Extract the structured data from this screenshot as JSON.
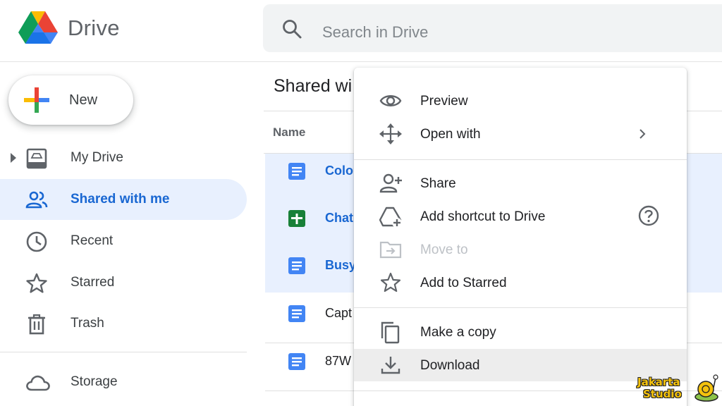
{
  "app": {
    "brand": "Drive"
  },
  "search": {
    "placeholder": "Search in Drive"
  },
  "sidebar": {
    "new_label": "New",
    "items": [
      {
        "label": "My Drive",
        "icon": "my-drive-icon"
      },
      {
        "label": "Shared with me",
        "icon": "people-icon",
        "active": true
      },
      {
        "label": "Recent",
        "icon": "clock-icon"
      },
      {
        "label": "Starred",
        "icon": "star-icon"
      },
      {
        "label": "Trash",
        "icon": "trash-icon"
      },
      {
        "label": "Storage",
        "icon": "cloud-icon"
      }
    ]
  },
  "main": {
    "title": "Shared wi",
    "column_name": "Name",
    "files": [
      {
        "name": "Colo",
        "type": "doc",
        "selected": true
      },
      {
        "name": "Chat",
        "type": "sheet",
        "selected": true
      },
      {
        "name": "Busy",
        "type": "doc",
        "selected": true
      },
      {
        "name": "Capt",
        "type": "doc",
        "selected": false
      },
      {
        "name": "87W",
        "type": "doc",
        "selected": false
      }
    ]
  },
  "context_menu": {
    "items": [
      {
        "label": "Preview",
        "icon": "eye-icon"
      },
      {
        "label": "Open with",
        "icon": "move-arrows-icon",
        "submenu": true
      },
      {
        "label": "Share",
        "icon": "person-add-icon"
      },
      {
        "label": "Add shortcut to Drive",
        "icon": "add-shortcut-icon",
        "help": true
      },
      {
        "label": "Move to",
        "icon": "folder-move-icon",
        "disabled": true
      },
      {
        "label": "Add to Starred",
        "icon": "star-outline-icon"
      },
      {
        "label": "Make a copy",
        "icon": "copy-icon"
      },
      {
        "label": "Download",
        "icon": "download-icon",
        "hovered": true
      }
    ]
  },
  "watermark": {
    "line1": "Jakarta",
    "line2": "Studio"
  },
  "colors": {
    "accent": "#1967d2",
    "active_bg": "#e8f0fe",
    "doc_blue": "#4285f4",
    "sheet_green": "#188038"
  }
}
